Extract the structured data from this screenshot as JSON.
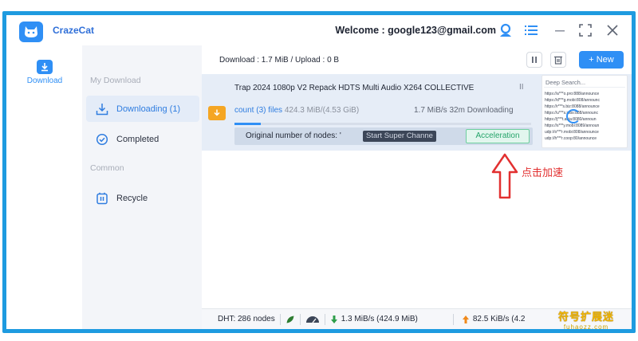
{
  "app": {
    "name": "CrazeCat"
  },
  "header": {
    "welcome": "Welcome : google123@gmail.com"
  },
  "rail": {
    "download_label": "Download"
  },
  "sidebar": {
    "section_my_download": "My Download",
    "downloading_label": "Downloading (1)",
    "completed_label": "Completed",
    "section_common": "Common",
    "recycle_label": "Recycle"
  },
  "toolbar": {
    "stats": "Download : 1.7 MiB / Upload : 0 B",
    "new_label": "+ New"
  },
  "task": {
    "title": "Trap 2024 1080p V2 Repack HDTS Multi Audio X264 COLLECTIVE",
    "pause_glyph": "II",
    "files_count": "count (3) files",
    "size": "424.3 MiB/(4.53 GiB)",
    "speed": "1.7 MiB/s",
    "eta": "32m",
    "state": "Downloading",
    "progress": 0.09,
    "accel_label": "Original number of nodes: '",
    "super_channel_label": "Start Super Channe",
    "accel_button": "Acceleration"
  },
  "deep_search": {
    "placeholder": "Deep Search...",
    "lines": [
      "https://a***o.pro:888/announce",
      "https://d***g.mobi:808/announc",
      "https://r***s.biz:8088/announce",
      "https://u***s.jobs:888/announc",
      "https://j***t.asia:8080/announ",
      "https://s***y.mobi:8089/announ",
      "udp://o***r.mobi:808/announce",
      "udp://h***r.coop:80/announce"
    ]
  },
  "statusbar": {
    "dht": "DHT: 286 nodes",
    "down": "1.3 MiB/s (424.9 MiB)",
    "up": "82.5 KiB/s (4.2"
  },
  "annotation": {
    "note": "点击加速"
  },
  "watermark": {
    "top": "符号扩展迷",
    "bottom": "fuhaozz.com"
  },
  "colors": {
    "accent": "#2f8ff5",
    "frame": "#1e9be0",
    "accel_green": "#25a46a",
    "annotation_red": "#e23030",
    "folder_orange": "#f5a623"
  },
  "icons": {
    "logo": "cat-icon",
    "avatar": "user-icon",
    "menu": "list-icon",
    "minimize": "minimize-icon",
    "maximize": "maximize-icon",
    "close": "close-icon"
  }
}
